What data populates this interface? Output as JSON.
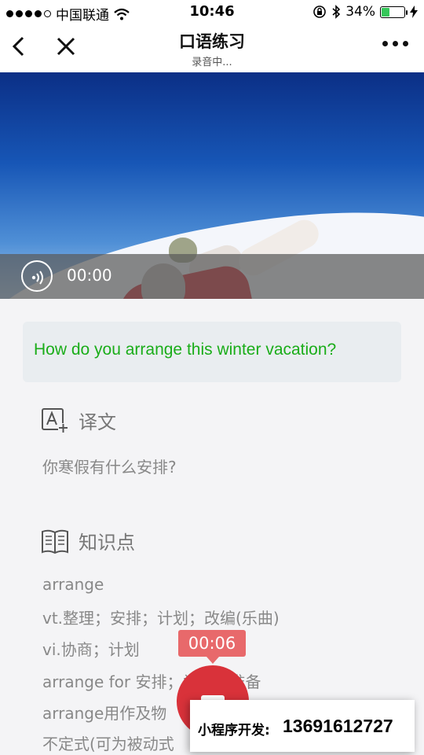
{
  "status_bar": {
    "carrier": "中国联通",
    "time": "10:46",
    "battery_percent": "34%",
    "battery_level": 0.34,
    "signal_dots_filled": 4,
    "signal_dots_total": 5
  },
  "nav": {
    "title": "口语练习",
    "subtitle": "录音中..."
  },
  "audio": {
    "current_time": "00:00"
  },
  "sentence": {
    "english": "How do you arrange this winter vacation?"
  },
  "translation": {
    "heading": "译文",
    "text": "你寒假有什么安排?"
  },
  "knowledge": {
    "heading": "知识点",
    "lines": [
      "arrange",
      "vt.整理；安排；计划；改编(乐曲)",
      "vi.协商；计划",
      "arrange for 安排；为…做准备",
      "arrange用作及物",
      "不定式(可为被动式"
    ]
  },
  "recording": {
    "elapsed": "00:06"
  },
  "promo": {
    "label": "小程序开发:",
    "phone": "13691612727"
  },
  "colors": {
    "accent_green": "#1aad19",
    "record_red": "#d9323a",
    "badge_red": "#e8696b"
  }
}
